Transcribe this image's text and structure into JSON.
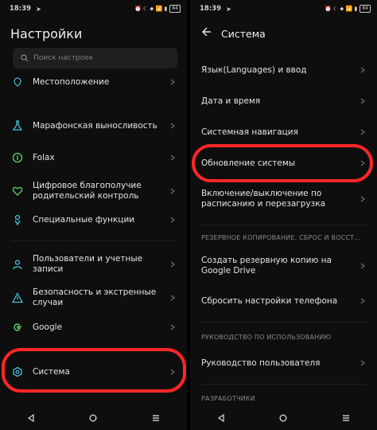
{
  "status_left": {
    "time": "18:39",
    "nav": "➤",
    "icons": "⏰ ☾ ⬥ 📶 ▮",
    "battery": "84"
  },
  "status_right": {
    "time": "18:39",
    "nav": "➤",
    "icons": "⏰ ☾ ⬥ 📶 ▮",
    "battery": "84"
  },
  "left": {
    "title": "Настройки",
    "search_placeholder": "Поиск настроек",
    "items": [
      {
        "label": "Местоположение",
        "icon": "location-icon"
      },
      {
        "label": "Марафонская выносливость",
        "icon": "flask-icon"
      },
      {
        "label": "Folax",
        "icon": "folax-icon"
      },
      {
        "label": "Цифровое благополучие\nродительский контроль",
        "icon": "heart-shield-icon"
      },
      {
        "label": "Специальные функции",
        "icon": "accessibility-icon"
      },
      {
        "label": "Пользователи и учетные\nзаписи",
        "icon": "user-icon"
      },
      {
        "label": "Безопасность и экстренные\nслучаи",
        "icon": "warning-icon"
      },
      {
        "label": "Google",
        "icon": "google-icon"
      },
      {
        "label": "Система",
        "icon": "system-icon"
      }
    ]
  },
  "right": {
    "title": "Система",
    "items": [
      {
        "label": "Язык(Languages) и ввод"
      },
      {
        "label": "Дата и время"
      },
      {
        "label": "Системная навигация"
      },
      {
        "label": "Обновление системы"
      },
      {
        "label": "Включение/выключение по\nрасписанию и перезагрузка"
      },
      {
        "label": "Создать резервную копию на\nGoogle Drive"
      },
      {
        "label": "Сбросить настройки телефона"
      },
      {
        "label": "Руководство пользователя"
      }
    ],
    "sections": {
      "backup": "РЕЗЕРВНОЕ КОПИРОВАНИЕ, СБРОС И ВОССТ...",
      "manual": "РУКОВОДСТВО ПО ИСПОЛЬЗОВАНИЮ",
      "dev": "РАЗРАБОТЧИКИ"
    }
  },
  "colors": {
    "highlight": "#ff2626",
    "bg": "#0e0e0e",
    "text": "#e4e4e4"
  }
}
